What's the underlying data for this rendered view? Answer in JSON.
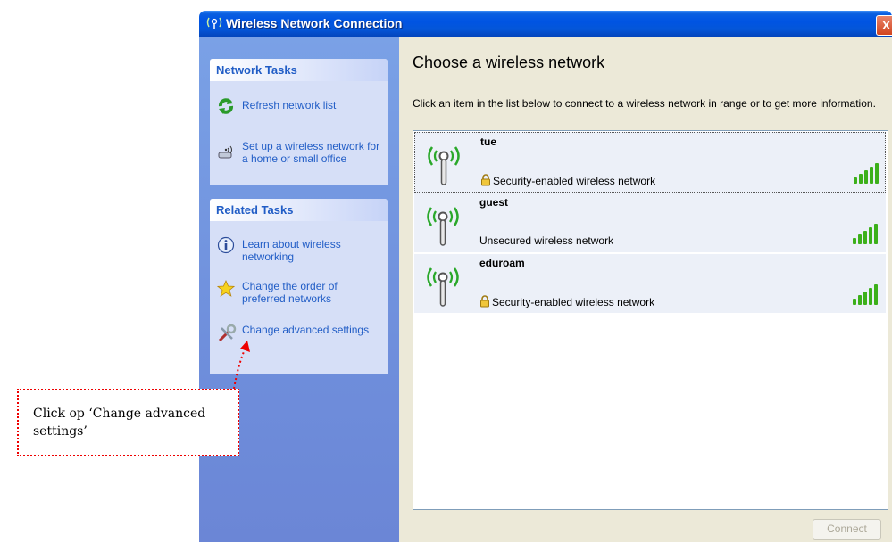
{
  "window": {
    "title": "Wireless Network Connection",
    "title_icon": "wireless-signal-icon",
    "close_label": "X"
  },
  "sidebar": {
    "network_tasks": {
      "header": "Network Tasks",
      "items": [
        {
          "label": "Refresh network list",
          "icon": "refresh-icon"
        },
        {
          "label": "Set up a wireless network for a home or small office",
          "icon": "wireless-setup-icon"
        }
      ]
    },
    "related_tasks": {
      "header": "Related Tasks",
      "items": [
        {
          "label": "Learn about wireless networking",
          "icon": "info-icon"
        },
        {
          "label": "Change the order of preferred networks",
          "icon": "star-icon"
        },
        {
          "label": "Change advanced settings",
          "icon": "tools-icon"
        }
      ]
    }
  },
  "main": {
    "heading": "Choose a wireless network",
    "description": "Click an item in the list below to connect to a wireless network in range or to get more information.",
    "networks": [
      {
        "name": "tue",
        "status": "Security-enabled wireless network",
        "secured": true,
        "signal_bars": 5
      },
      {
        "name": "guest",
        "status": "Unsecured wireless network",
        "secured": false,
        "signal_bars": 5
      },
      {
        "name": "eduroam",
        "status": "Security-enabled wireless network",
        "secured": true,
        "signal_bars": 5
      }
    ],
    "connect_label": "Connect"
  },
  "annotation": {
    "text": "Click op ‘Change advanced settings’"
  },
  "colors": {
    "title_bar": "#0054e3",
    "sidebar": "#7aa1e6",
    "task_link": "#215dc6",
    "signal_green": "#3cb01a",
    "annotation_red": "#e00000"
  }
}
